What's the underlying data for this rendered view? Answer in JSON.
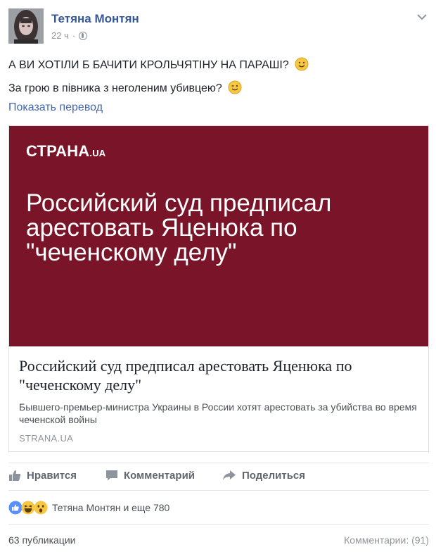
{
  "post": {
    "author": "Тетяна Монтян",
    "time": "22 ч",
    "privacy_icon": "globe-icon",
    "lines": [
      "А ВИ ХОТІЛИ Б БАЧИТИ КРОЛЬЧЯТІНУ НА ПАРАШІ?",
      "За грою в півника з неголеним убивцею?"
    ],
    "translate_link": "Показать перевод"
  },
  "card": {
    "logo": "СТРАНА",
    "logo_suffix": ".UA",
    "image_headline": "Российский суд предписал арестовать Яценюка по \"чеченскому делу\"",
    "title": "Российский суд предписал арестовать Яценюка по \"чеченскому делу\"",
    "description": "Бывшего-премьер-министра Украины в России хотят арестовать за убийства во время чеченской войны",
    "domain": "STRANA.UA",
    "background_color": "#7a1529"
  },
  "actions": {
    "like": "Нравится",
    "comment": "Комментарий",
    "share": "Поделиться"
  },
  "reactions": {
    "summary": "Тетяна Монтян и еще 780",
    "icons": [
      "like-icon",
      "haha-icon",
      "wow-icon"
    ]
  },
  "footer": {
    "shares": "63 публикации",
    "comments": "Комментарии: (91)"
  },
  "colors": {
    "link": "#4267b2",
    "author": "#365899",
    "muted": "#90949c"
  }
}
